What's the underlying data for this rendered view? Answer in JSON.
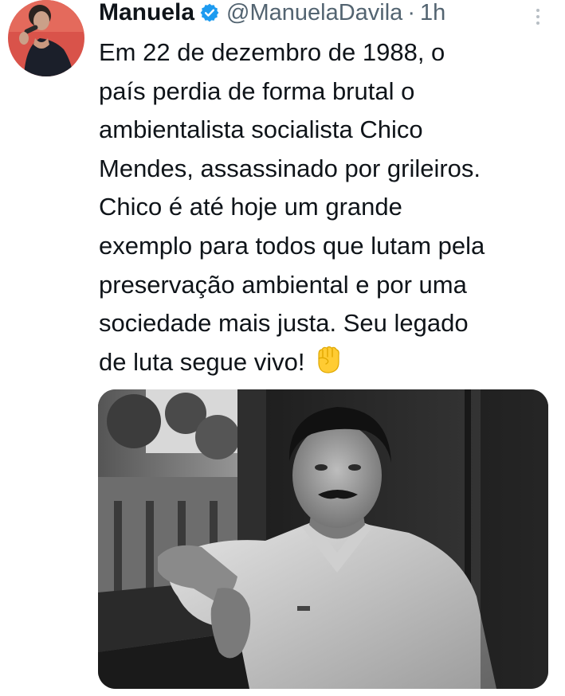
{
  "tweet": {
    "display_name": "Manuela",
    "verified": true,
    "handle": "@ManuelaDavila",
    "separator": "·",
    "time": "1h",
    "lines": [
      "Em 22 de dezembro de 1988, o",
      "país perdia de forma brutal o",
      "ambientalista socialista Chico",
      "Mendes, assassinado por grileiros.",
      "Chico é até hoje um grande",
      "exemplo para todos que lutam pela",
      "preservação ambiental e por uma",
      "sociedade mais justa. Seu legado",
      "de luta segue vivo!"
    ],
    "emoji": "raised-fist",
    "media": {
      "type": "photo",
      "style": "black-and-white"
    }
  },
  "colors": {
    "text_primary": "#0f1419",
    "text_secondary": "#536471",
    "verified_blue": "#1d9bf0",
    "emoji_yellow": "#ffcc33"
  },
  "icons": {
    "verified": "verified-badge-icon",
    "more": "more-options-icon",
    "emoji": "raised-fist-emoji"
  }
}
